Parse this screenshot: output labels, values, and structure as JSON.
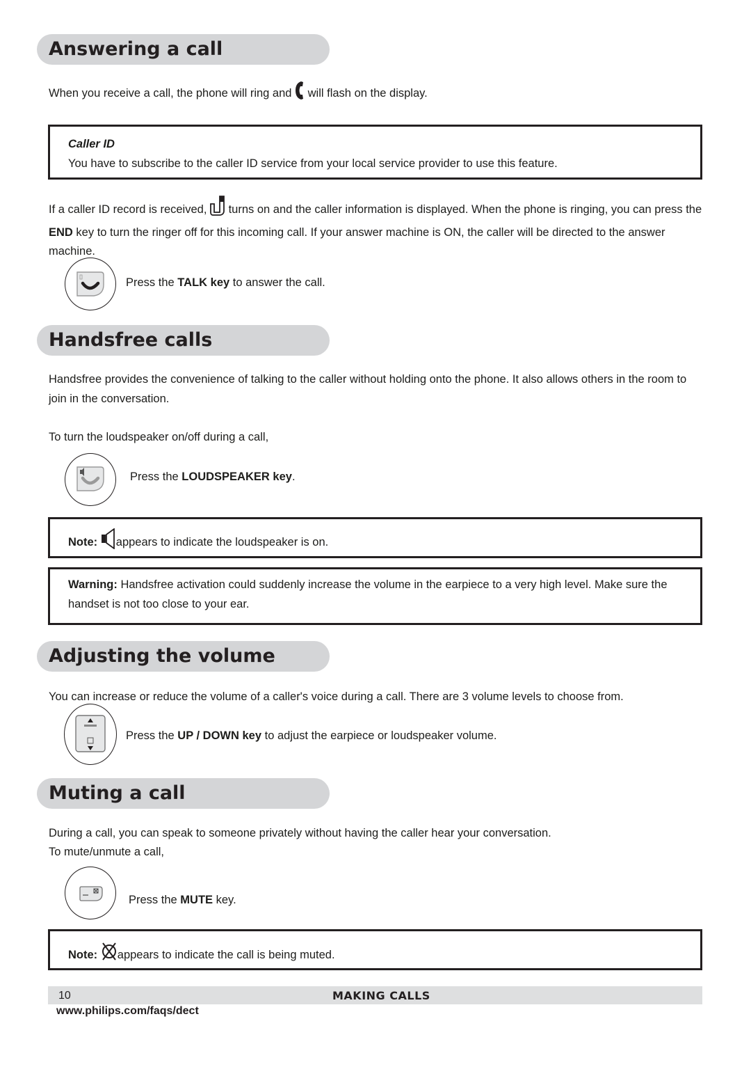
{
  "sections": {
    "answering": {
      "title": "Answering a call",
      "intro_before_icon": "When you receive a call, the phone will ring and ",
      "intro_icon": "handset-icon",
      "intro_after_icon": " will flash on the display.",
      "callerid_box": {
        "title": "Caller ID",
        "text": "You have to subscribe to the caller ID service from your local service provider to use this feature."
      },
      "callerid_para": {
        "before_icon": "If a caller ID record is received, ",
        "icon": "caller-id-icon",
        "after_icon_1": " turns on and the caller information is displayed. When the phone is ringing, you can press the ",
        "bold_1": "END",
        "after_bold_1": " key to turn the ringer off for this incoming call.  If your answer machine is ON, the caller will be directed to the answer machine."
      },
      "key_instruction": {
        "icon": "talk-key-icon",
        "prefix": "Press the ",
        "bold": "TALK key",
        "suffix": " to answer the call."
      }
    },
    "handsfree": {
      "title": "Handsfree calls",
      "para1": "Handsfree provides the convenience of talking to the caller without holding onto the phone.  It also allows others in the room to join in the conversation.",
      "para2": "To turn the loudspeaker on/off during a call,",
      "key_instruction": {
        "icon": "loudspeaker-key-icon",
        "prefix": "Press the ",
        "bold": "LOUDSPEAKER key",
        "suffix": "."
      },
      "note": {
        "label": "Note:",
        "icon": "loudspeaker-icon",
        "text": "appears to indicate the loudspeaker is on."
      },
      "warning": {
        "label": "Warning:",
        "text": " Handsfree activation could suddenly increase the volume in the earpiece to a very high level. Make sure the handset is not too close to your ear."
      }
    },
    "volume": {
      "title": "Adjusting the volume",
      "para1": "You can increase or reduce the volume of a caller's voice during a call.  There are 3 volume levels to choose from.",
      "key_instruction": {
        "icon": "up-down-key-icon",
        "prefix": "Press the ",
        "bold": "UP / DOWN key",
        "suffix": " to adjust the earpiece or loudspeaker volume."
      }
    },
    "muting": {
      "title": "Muting a call",
      "para1": "During a call, you can speak to someone privately without having the caller hear your conversation.",
      "para2": "To mute/unmute a call,",
      "key_instruction": {
        "icon": "mute-key-icon",
        "prefix": "Press the ",
        "bold": "MUTE",
        "suffix": " key."
      },
      "note": {
        "label": "Note:",
        "icon": "mute-icon",
        "text": "appears to indicate the call is being muted."
      }
    }
  },
  "footer": {
    "page_number": "10",
    "section_label": "MAKING CALLS",
    "url": "www.philips.com/faqs/dect"
  },
  "colors": {
    "heading_bg": "#d4d5d7",
    "footer_bg": "#dedfe0",
    "text": "#1d1d1b"
  }
}
